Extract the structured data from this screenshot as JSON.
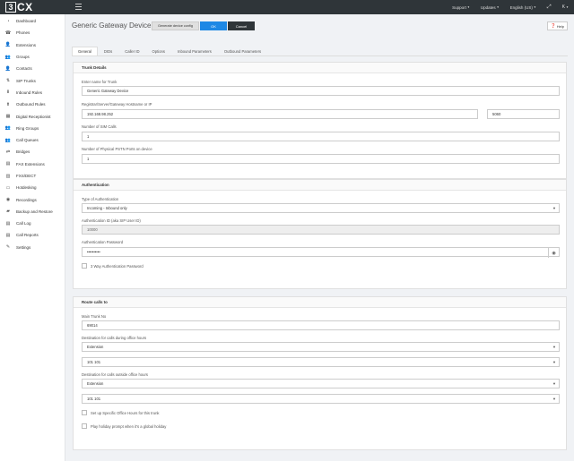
{
  "topbar": {
    "logo_box": "3",
    "logo_text": "CX",
    "nav": [
      {
        "label": "Support"
      },
      {
        "label": "Updates"
      },
      {
        "label": "English (US)"
      }
    ],
    "user_label": "K"
  },
  "sidebar": {
    "items": [
      {
        "label": "Dashboard",
        "icon": "dashboard-icon",
        "glyph": "◔"
      },
      {
        "label": "Phones",
        "icon": "phone-icon",
        "glyph": "☎"
      },
      {
        "label": "Extensions",
        "icon": "user-icon",
        "glyph": "👤"
      },
      {
        "label": "Groups",
        "icon": "group-icon",
        "glyph": "👥"
      },
      {
        "label": "Contacts",
        "icon": "contacts-icon",
        "glyph": "👤"
      },
      {
        "label": "SIP Trunks",
        "icon": "trunk-icon",
        "glyph": "⇅"
      },
      {
        "label": "Inbound Rules",
        "icon": "inbound-icon",
        "glyph": "⬇"
      },
      {
        "label": "Outbound Rules",
        "icon": "outbound-icon",
        "glyph": "⬆"
      },
      {
        "label": "Digital Receptionist",
        "icon": "receptionist-icon",
        "glyph": "▦"
      },
      {
        "label": "Ring Groups",
        "icon": "ring-group-icon",
        "glyph": "👥"
      },
      {
        "label": "Call Queues",
        "icon": "queue-icon",
        "glyph": "👥"
      },
      {
        "label": "Bridges",
        "icon": "bridge-icon",
        "glyph": "⇄"
      },
      {
        "label": "FAX Extensions",
        "icon": "fax-icon",
        "glyph": "▤"
      },
      {
        "label": "FXS/DECT",
        "icon": "fxs-icon",
        "glyph": "▥"
      },
      {
        "label": "Hotdesking",
        "icon": "hotdesk-icon",
        "glyph": "▭"
      },
      {
        "label": "Recordings",
        "icon": "recordings-icon",
        "glyph": "◉"
      },
      {
        "label": "Backup and Restore",
        "icon": "folder-icon",
        "glyph": "▰"
      },
      {
        "label": "Call Log",
        "icon": "call-log-icon",
        "glyph": "▤"
      },
      {
        "label": "Call Reports",
        "icon": "reports-icon",
        "glyph": "▤"
      },
      {
        "label": "Settings",
        "icon": "wrench-icon",
        "glyph": "✎"
      }
    ]
  },
  "header": {
    "title": "Generic Gateway Device",
    "generate_label": "Generate device config",
    "ok_label": "OK",
    "cancel_label": "Cancel",
    "help_label": "Help"
  },
  "tabs": [
    {
      "label": "General"
    },
    {
      "label": "DIDs"
    },
    {
      "label": "Caller ID"
    },
    {
      "label": "Options"
    },
    {
      "label": "Inbound Parameters"
    },
    {
      "label": "Outbound Parameters"
    }
  ],
  "trunk_details": {
    "heading": "Trunk Details",
    "name_label": "Enter name for Trunk",
    "name_value": "Generic Gateway Device",
    "host_label": "Registrar/Server/Gateway Hostname or IP",
    "host_value": "192.168.98.252",
    "port_value": "5060",
    "sim_label": "Number of SIM Calls",
    "sim_value": "1",
    "ports_label": "Number of Physical PSTN Ports on device",
    "ports_value": "1"
  },
  "authentication": {
    "heading": "Authentication",
    "type_label": "Type of Authentication",
    "type_value": "Incoming - Inbound only",
    "id_label": "Authentication ID (aka SIP User ID)",
    "id_value": "10000",
    "password_label": "Authentication Password",
    "password_value": "••••••••••",
    "three_way_label": "3 Way Authentication Password"
  },
  "route_calls": {
    "heading": "Route calls to",
    "main_trunk_label": "Main Trunk No",
    "main_trunk_value": "69014",
    "office_label": "Destination for calls during office hours",
    "office_type": "Extension",
    "office_target": "101 101",
    "outside_label": "Destination for calls outside office hours",
    "outside_type": "Extension",
    "outside_target": "101 101",
    "specific_hours_label": "Set up Specific Office Hours for this trunk",
    "holiday_label": "Play holiday prompt when it's a global holiday"
  }
}
